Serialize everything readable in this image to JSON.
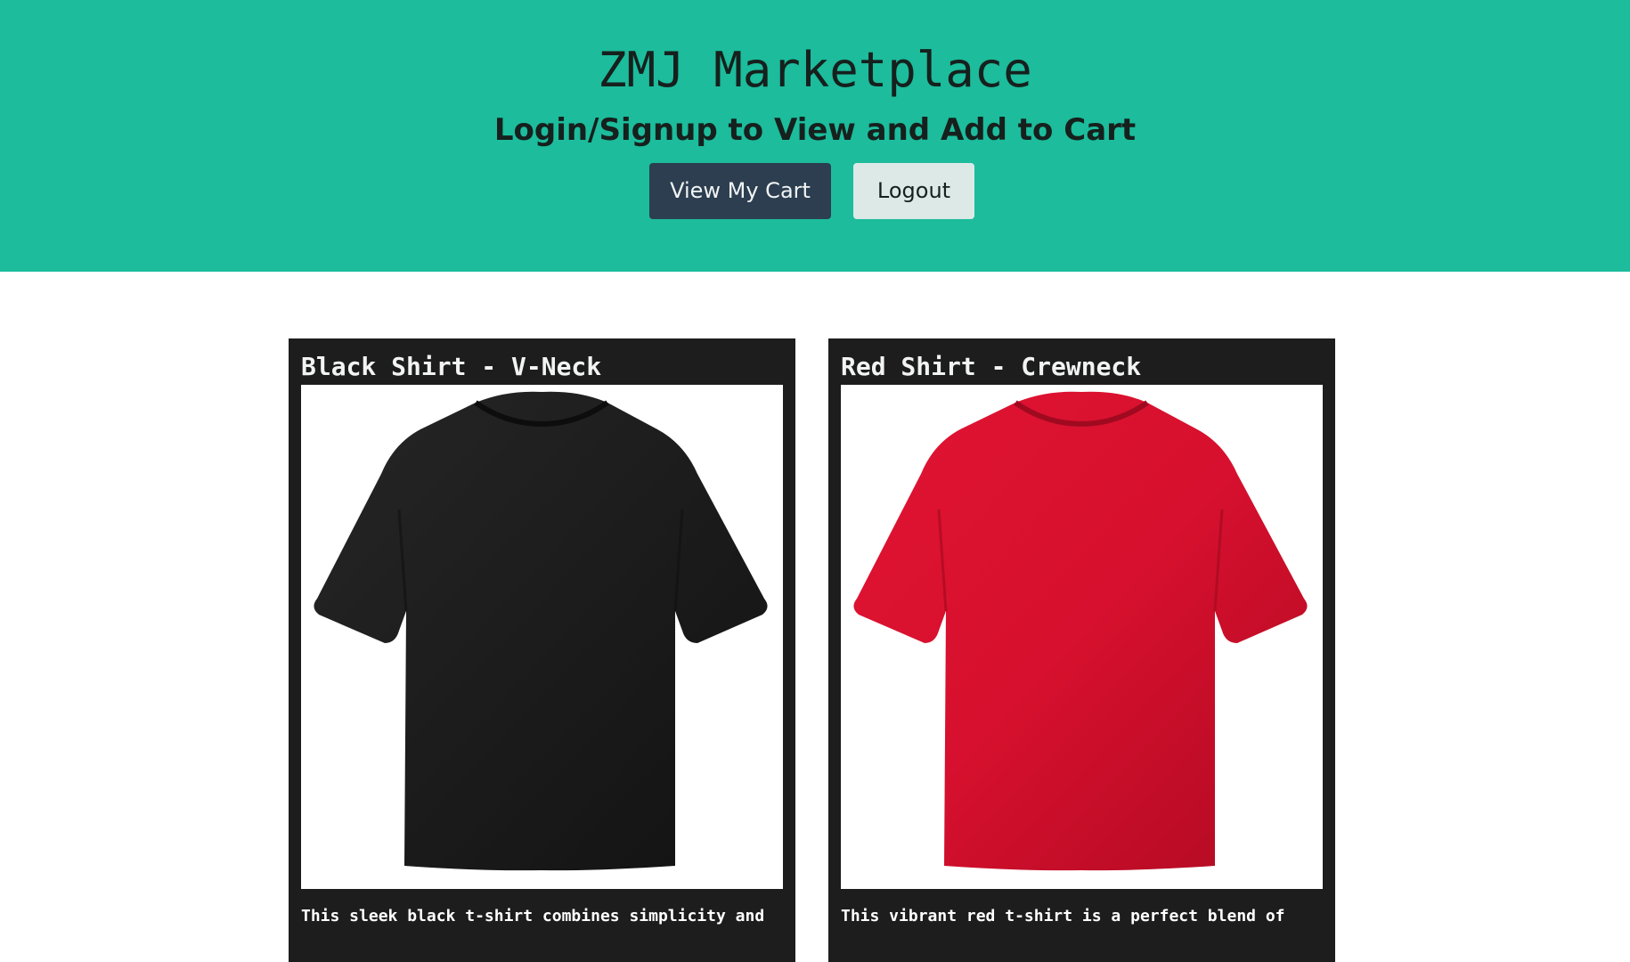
{
  "header": {
    "title": "ZMJ Marketplace",
    "subtitle": "Login/Signup to View and Add to Cart",
    "view_cart_label": "View My Cart",
    "logout_label": "Logout",
    "background_color": "#1cbc9c"
  },
  "products": [
    {
      "name": "Black Shirt - V-Neck",
      "image_icon": "black-tshirt-image",
      "shirt_color": "#1c1c1c",
      "description": "This sleek black t-shirt combines simplicity and"
    },
    {
      "name": "Red Shirt - Crewneck",
      "image_icon": "red-tshirt-image",
      "shirt_color": "#d6102e",
      "description": "This vibrant red t-shirt is a perfect blend of"
    }
  ]
}
